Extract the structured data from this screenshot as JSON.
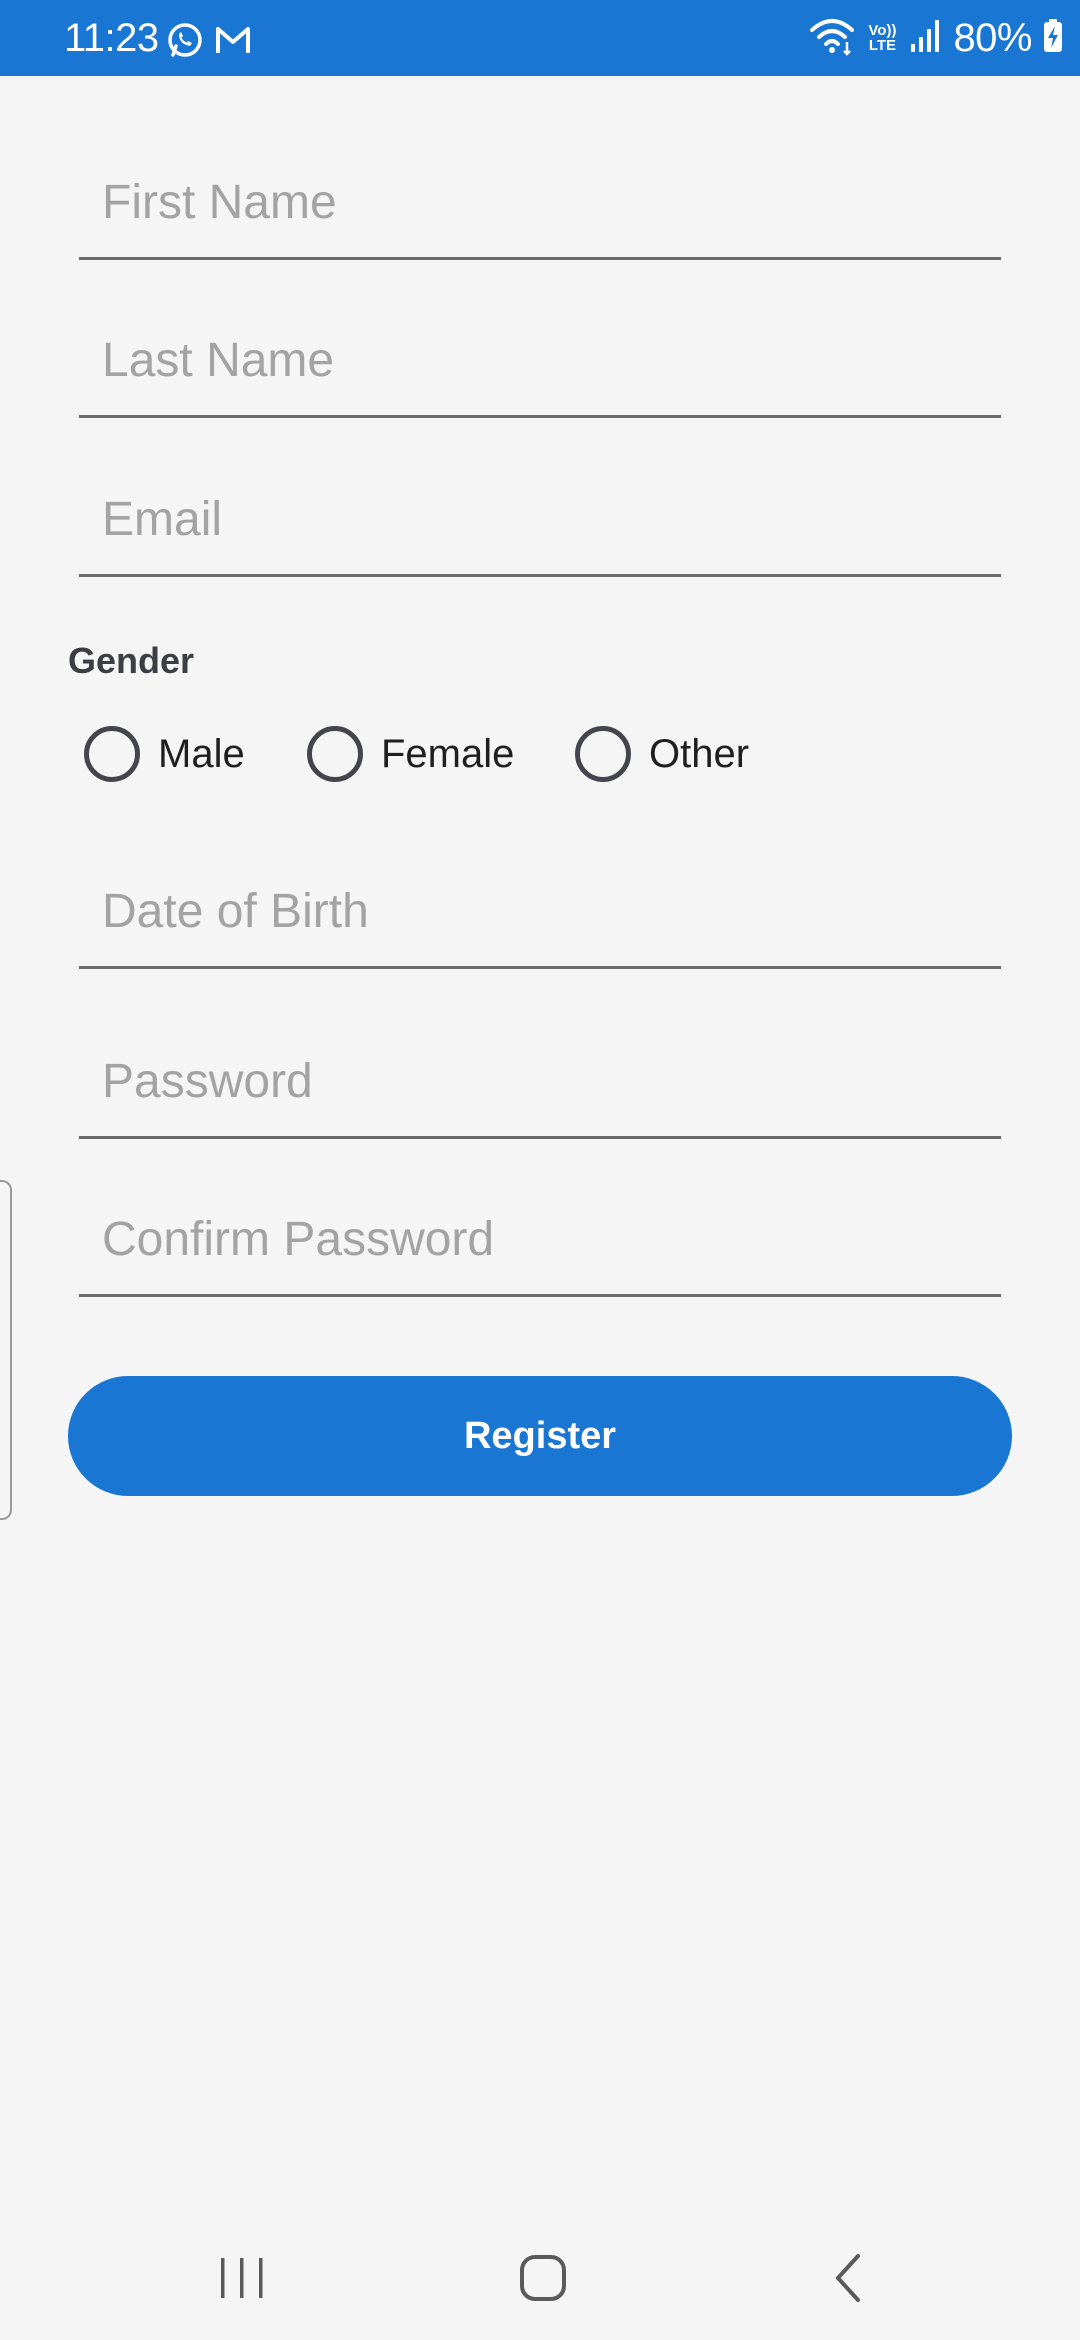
{
  "status_bar": {
    "time": "11:23",
    "battery": "80%",
    "volte_top": "Vo))",
    "volte_bottom": "LTE",
    "left_icons": [
      "whatsapp-icon",
      "gmail-icon"
    ],
    "right_icons": [
      "wifi-icon",
      "volte-icon",
      "signal-icon",
      "battery-charging-icon"
    ],
    "color": "#1976d3"
  },
  "form": {
    "first_name": {
      "placeholder": "First Name",
      "value": ""
    },
    "last_name": {
      "placeholder": "Last Name",
      "value": ""
    },
    "email": {
      "placeholder": "Email",
      "value": ""
    },
    "gender": {
      "label": "Gender",
      "options": [
        {
          "label": "Male",
          "selected": false
        },
        {
          "label": "Female",
          "selected": false
        },
        {
          "label": "Other",
          "selected": false
        }
      ]
    },
    "date_of_birth": {
      "placeholder": "Date of Birth",
      "value": ""
    },
    "password": {
      "placeholder": "Password",
      "value": ""
    },
    "confirm_password": {
      "placeholder": "Confirm Password",
      "value": ""
    },
    "register_label": "Register"
  },
  "nav_bar": {
    "icons": [
      "recent-apps-icon",
      "home-icon",
      "back-icon"
    ]
  },
  "colors": {
    "accent": "#1976d3",
    "background": "#f5f5f6",
    "placeholder": "#a3a3a3",
    "underline": "#6b6b6b"
  }
}
